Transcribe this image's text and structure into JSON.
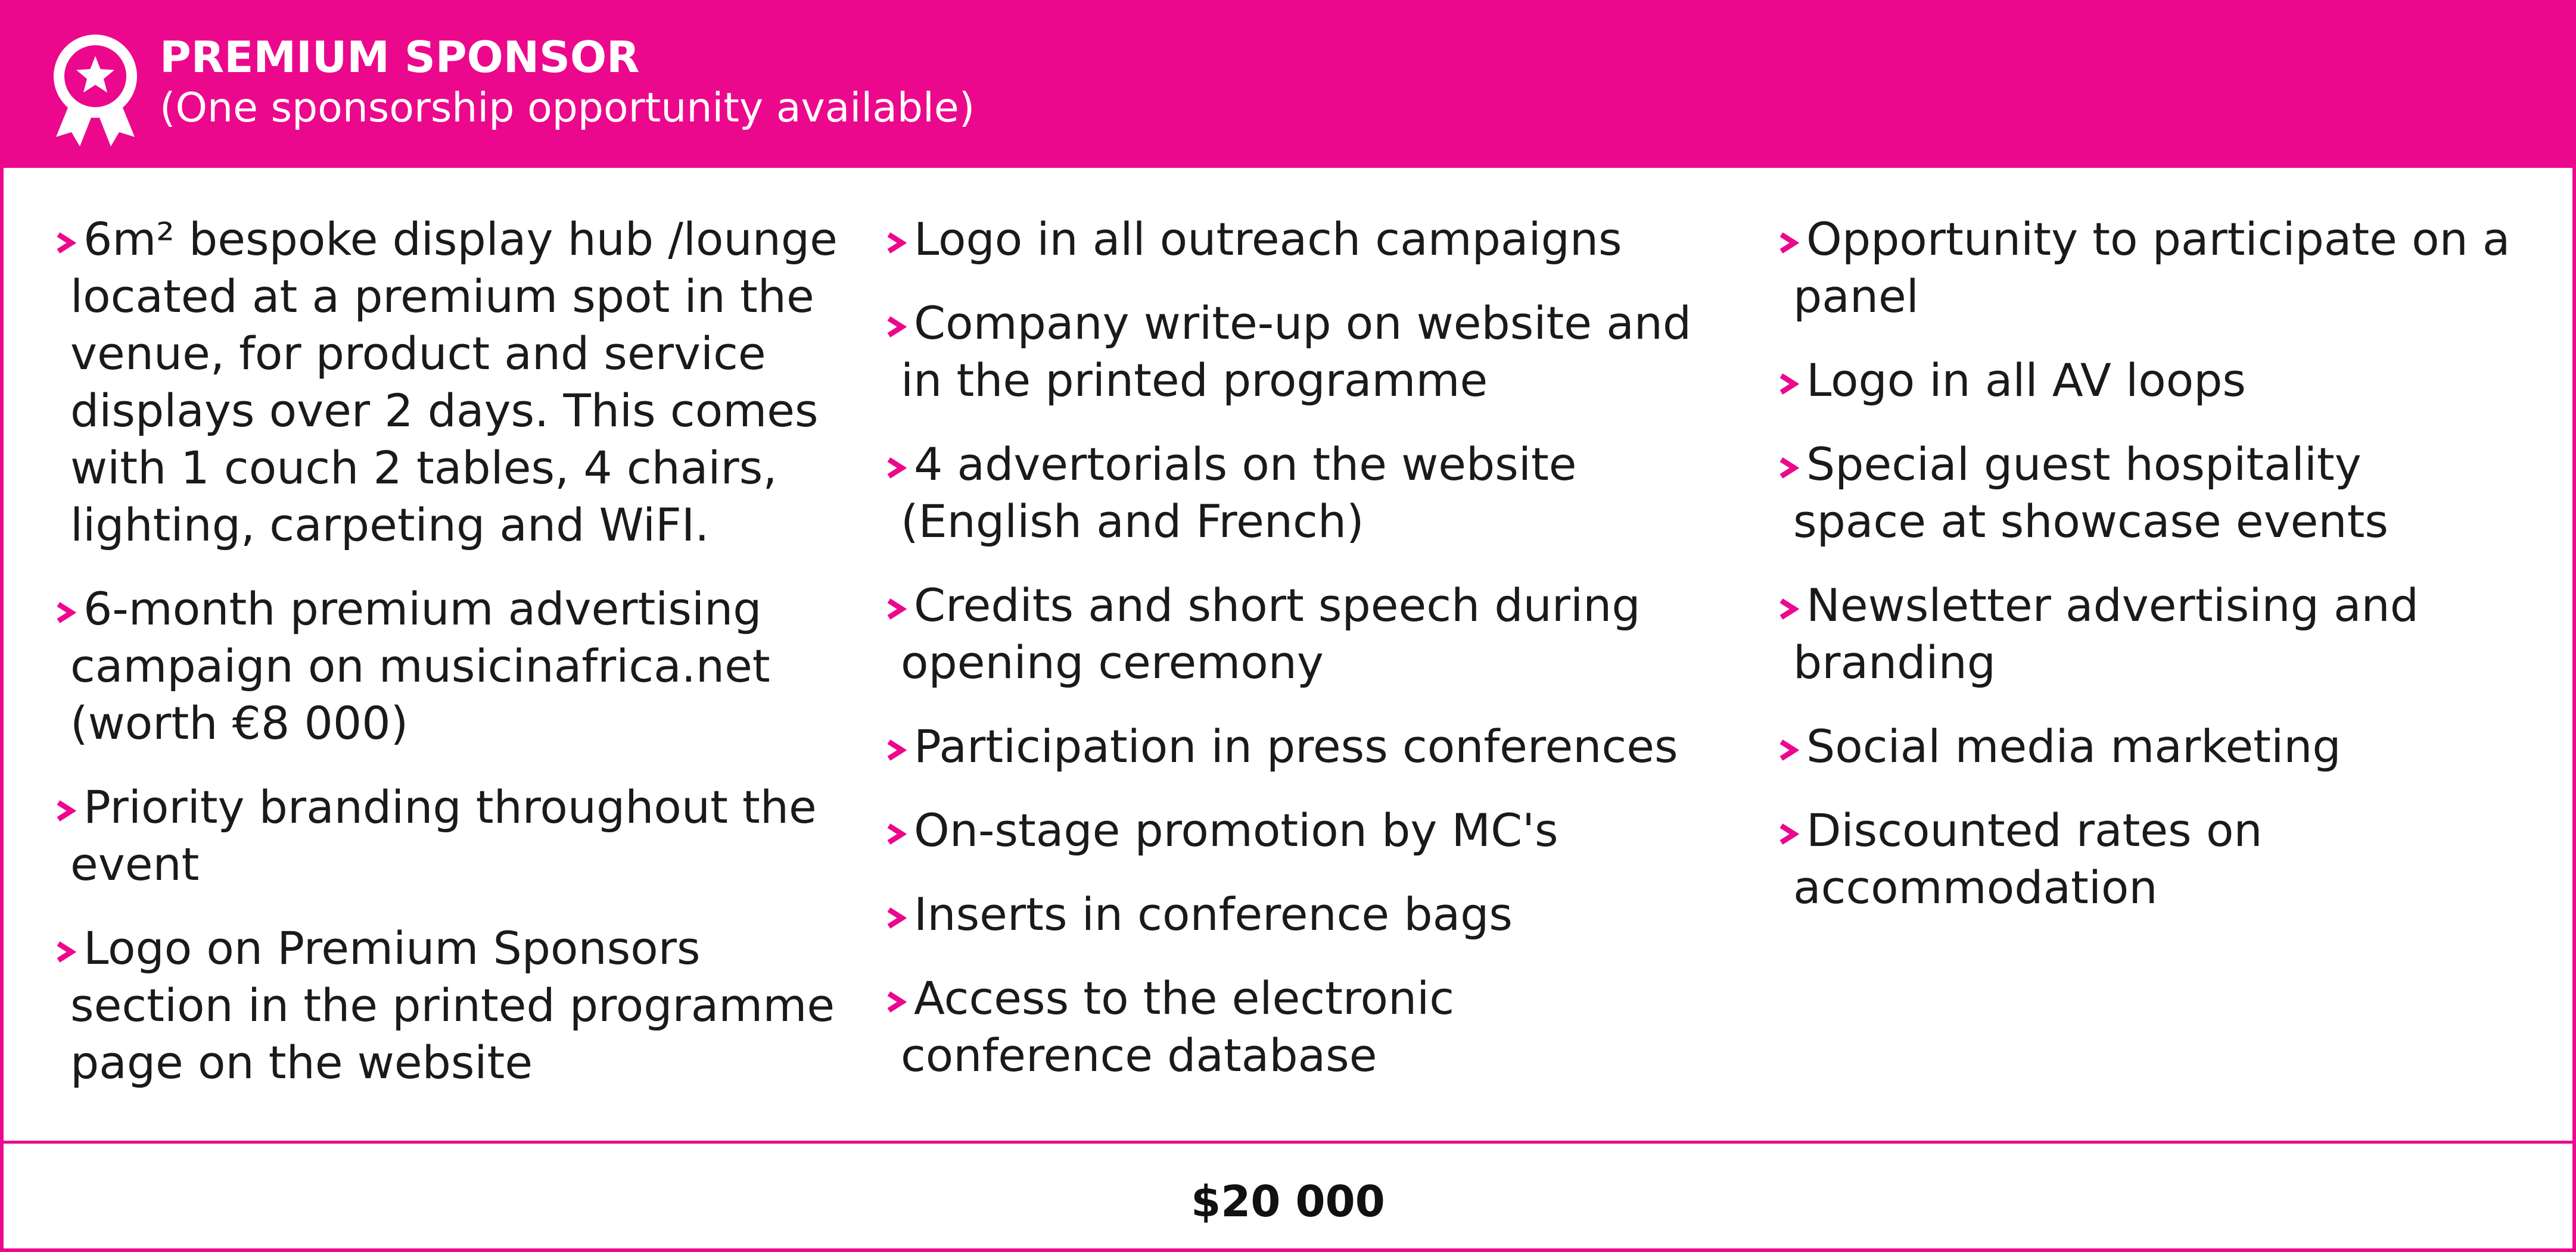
{
  "colors": {
    "accent": "#ec088c",
    "text": "#1a1a1a",
    "background": "#ffffff"
  },
  "header": {
    "icon": "award-ribbon-star-icon",
    "title": "PREMIUM SPONSOR",
    "subtitle": "(One sponsorship opportunity available)"
  },
  "columns": [
    {
      "items": [
        "6m² bespoke display hub /lounge\nlocated at a premium spot in the\nvenue, for product and service\ndisplays over 2 days. This comes\nwith 1 couch 2 tables, 4 chairs,\nlighting, carpeting and WiFI.",
        "6-month premium advertising\ncampaign on musicinafrica.net\n(worth €8 000)",
        "Priority branding throughout the\nevent",
        "Logo on Premium Sponsors\nsection in the printed programme\npage on the website"
      ]
    },
    {
      "items": [
        "Logo in all outreach campaigns",
        "Company write-up on website and\nin the printed programme",
        "4 advertorials on the website\n(English and French)",
        "Credits and short speech during\nopening ceremony",
        "Participation in press conferences",
        "On-stage promotion by MC's",
        "Inserts in conference bags",
        "Access to the electronic\nconference database"
      ]
    },
    {
      "items": [
        "Opportunity to participate on a\npanel",
        "Logo in all AV loops",
        "Special guest hospitality\nspace at showcase events",
        "Newsletter advertising and\nbranding",
        "Social media marketing",
        "Discounted rates on\naccommodation"
      ]
    }
  ],
  "bullet_icon": "chevron-right-icon",
  "footer": {
    "price": "$20 000"
  }
}
